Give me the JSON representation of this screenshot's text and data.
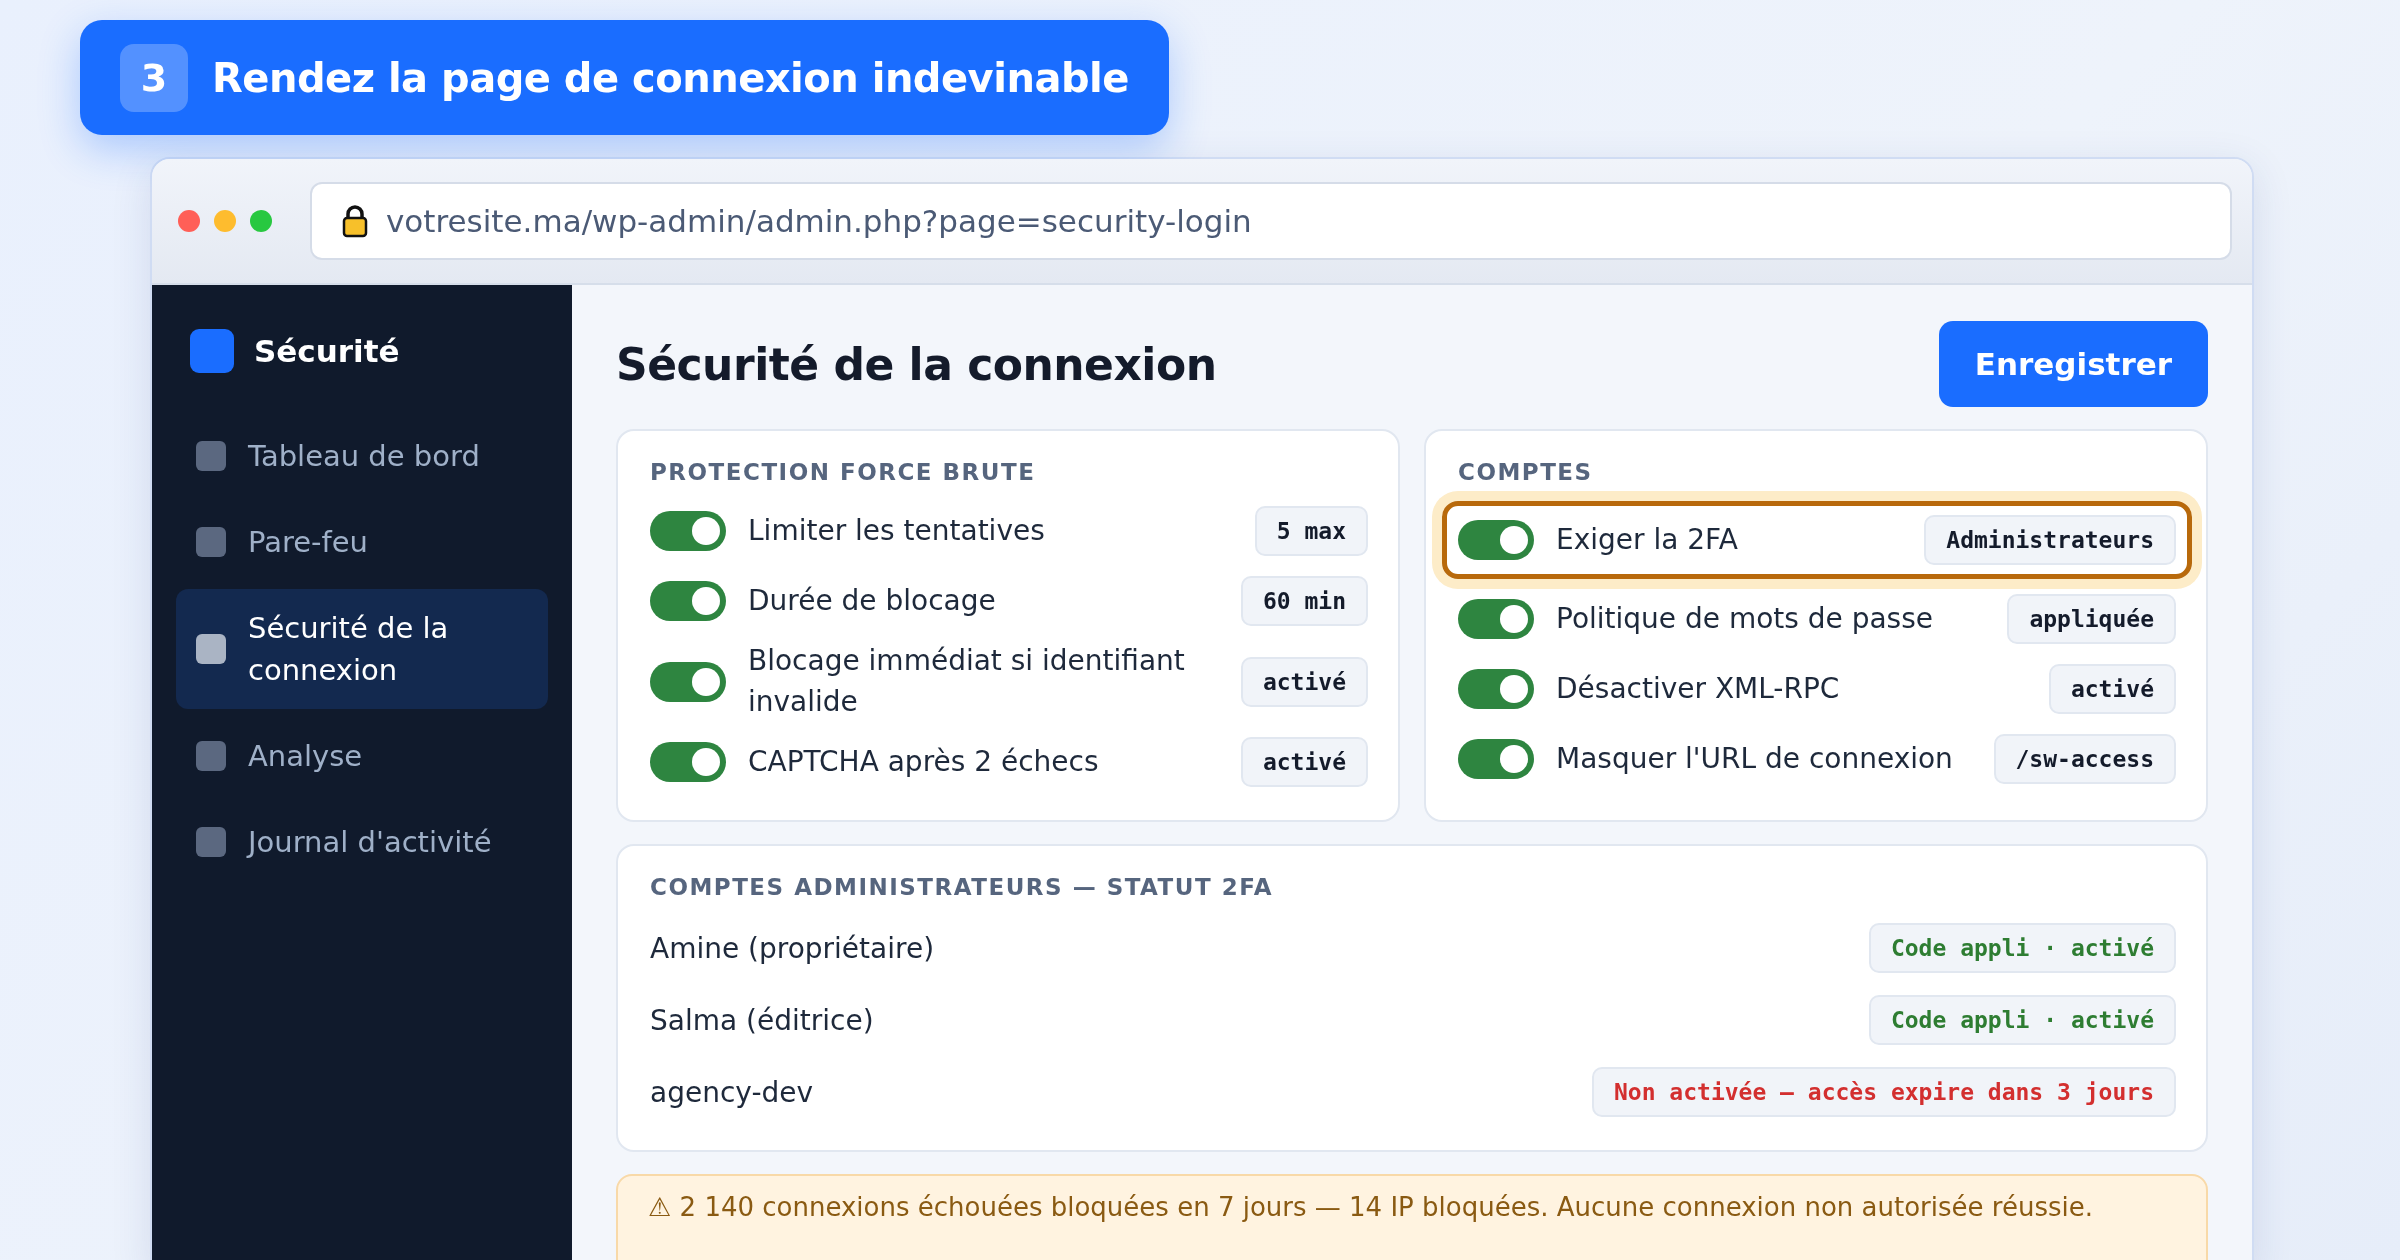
{
  "step": {
    "number": "3",
    "title": "Rendez la page de connexion indevinable"
  },
  "browser": {
    "url": "votresite.ma/wp-admin/admin.php?page=security-login"
  },
  "sidebar": {
    "brand": "Sécurité",
    "items": [
      {
        "label": "Tableau de bord",
        "selected": false
      },
      {
        "label": "Pare-feu",
        "selected": false
      },
      {
        "label": "Sécurité de la connexion",
        "selected": true
      },
      {
        "label": "Analyse",
        "selected": false
      },
      {
        "label": "Journal d'activité",
        "selected": false
      }
    ]
  },
  "page": {
    "title": "Sécurité de la connexion",
    "save_button": "Enregistrer"
  },
  "cards": [
    {
      "heading": "PROTECTION FORCE BRUTE",
      "rows": [
        {
          "label": "Limiter les tentatives",
          "on": true,
          "value": "5 max",
          "highlighted": false
        },
        {
          "label": "Durée de blocage",
          "on": true,
          "value": "60 min",
          "highlighted": false
        },
        {
          "label": "Blocage immédiat si identifiant invalide",
          "on": true,
          "value": "activé",
          "highlighted": false
        },
        {
          "label": "CAPTCHA après 2 échecs",
          "on": true,
          "value": "activé",
          "highlighted": false
        }
      ]
    },
    {
      "heading": "COMPTES",
      "rows": [
        {
          "label": "Exiger la 2FA",
          "on": true,
          "value": "Administrateurs",
          "highlighted": true
        },
        {
          "label": "Politique de mots de passe",
          "on": true,
          "value": "appliquée",
          "highlighted": false
        },
        {
          "label": "Désactiver XML-RPC",
          "on": true,
          "value": "activé",
          "highlighted": false
        },
        {
          "label": "Masquer l'URL de connexion",
          "on": true,
          "value": "/sw-access",
          "highlighted": false
        }
      ]
    }
  ],
  "admins": {
    "heading": "COMPTES ADMINISTRATEURS — STATUT 2FA",
    "rows": [
      {
        "name": "Amine (propriétaire)",
        "status": "Code appli · activé",
        "color": "#2e7d32"
      },
      {
        "name": "Salma (éditrice)",
        "status": "Code appli · activé",
        "color": "#2e7d32"
      },
      {
        "name": "agency-dev",
        "status": "Non activée — accès expire dans 3 jours",
        "color": "#d32f2f"
      }
    ]
  },
  "alert": {
    "text": "⚠ 2 140 connexions échouées bloquées en 7 jours — 14 IP bloquées. Aucune connexion non autorisée réussie."
  }
}
